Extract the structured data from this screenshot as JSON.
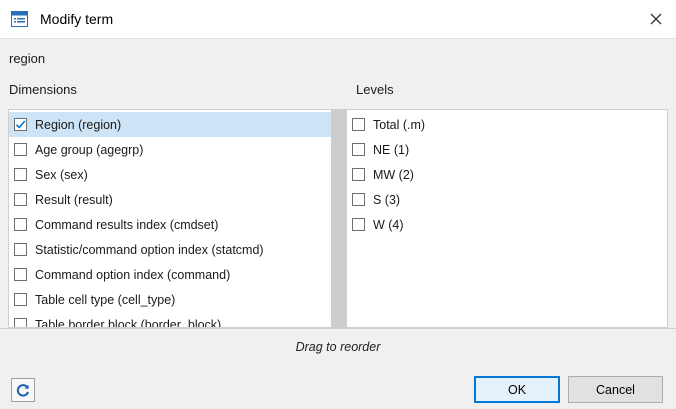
{
  "window": {
    "title": "Modify term",
    "close_icon": "close-icon",
    "app_icon": "window-list-icon"
  },
  "term": {
    "value": "region"
  },
  "dimensions": {
    "header": "Dimensions",
    "items": [
      {
        "label": "Region (region)",
        "checked": true,
        "selected": true
      },
      {
        "label": "Age group (agegrp)",
        "checked": false
      },
      {
        "label": "Sex (sex)",
        "checked": false
      },
      {
        "label": "Result (result)",
        "checked": false
      },
      {
        "label": "Command results index (cmdset)",
        "checked": false
      },
      {
        "label": "Statistic/command option index (statcmd)",
        "checked": false
      },
      {
        "label": "Command option index (command)",
        "checked": false
      },
      {
        "label": "Table cell type (cell_type)",
        "checked": false
      },
      {
        "label": "Table border block (border_block)",
        "checked": false
      }
    ]
  },
  "levels": {
    "header": "Levels",
    "items": [
      {
        "label": "Total (.m)",
        "checked": false
      },
      {
        "label": "NE (1)",
        "checked": false
      },
      {
        "label": "MW (2)",
        "checked": false
      },
      {
        "label": "S (3)",
        "checked": false
      },
      {
        "label": "W (4)",
        "checked": false
      }
    ]
  },
  "footer": {
    "hint": "Drag to reorder"
  },
  "buttons": {
    "refresh_icon": "refresh-icon",
    "ok": "OK",
    "cancel": "Cancel"
  },
  "colors": {
    "accent": "#0078d7",
    "selection": "#cde4f7"
  }
}
